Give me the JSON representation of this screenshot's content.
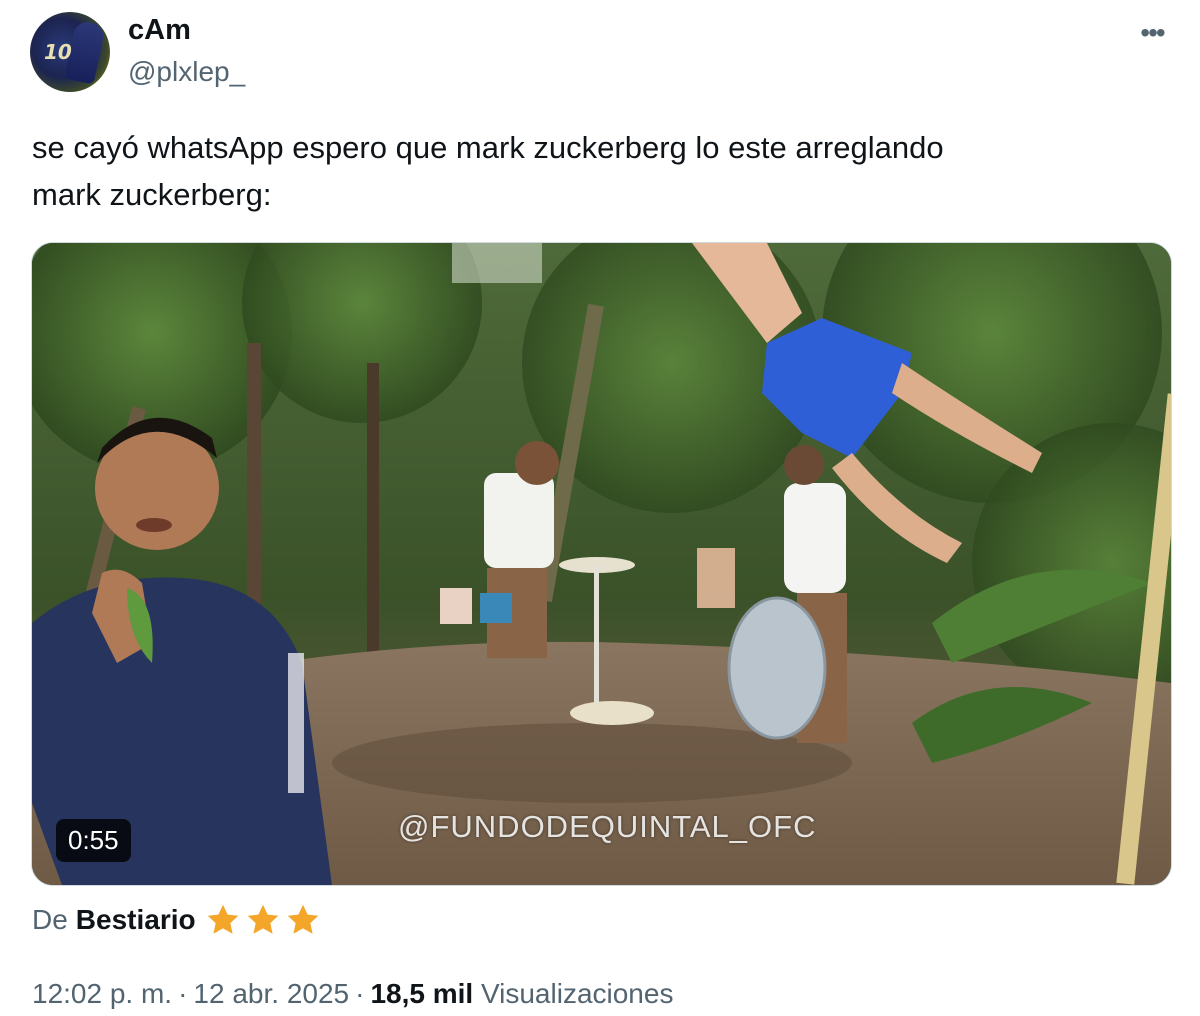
{
  "author": {
    "display_name": "cAm",
    "handle": "@plxlep_",
    "avatar_number": "10"
  },
  "header": {
    "more_icon": "more-horizontal-icon",
    "more_glyph": "•••"
  },
  "tweet": {
    "text_line1": "se cayó whatsApp espero que mark zuckerberg lo este arreglando",
    "text_line2": "mark zuckerberg:"
  },
  "media": {
    "duration": "0:55",
    "watermark": "@FUNDODEQUINTAL_OFC"
  },
  "via": {
    "prefix": "De",
    "source": "Bestiario",
    "stars": 3,
    "star_color": "#f4a62a"
  },
  "meta": {
    "time": "12:02 p. m.",
    "date": "12 abr. 2025",
    "separator": "·",
    "views_count": "18,5 mil",
    "views_label": "Visualizaciones"
  },
  "colors": {
    "text_primary": "#0f1419",
    "text_secondary": "#536471",
    "media_border": "#cfd9de"
  }
}
